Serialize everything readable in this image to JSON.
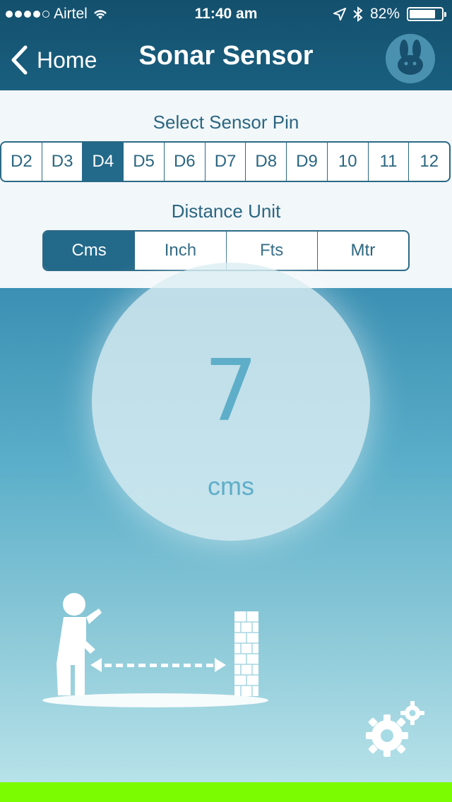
{
  "status_bar": {
    "carrier": "Airtel",
    "time": "11:40 am",
    "battery_percent": "82%",
    "battery_level": 0.82
  },
  "nav": {
    "back_label": "Home",
    "title": "Sonar Sensor",
    "icons": [
      "chevron-left-icon",
      "bunny-icon"
    ]
  },
  "sensor_pin": {
    "label": "Select Sensor Pin",
    "options": [
      "D2",
      "D3",
      "D4",
      "D5",
      "D6",
      "D7",
      "D8",
      "D9",
      "10",
      "11",
      "12"
    ],
    "selected": "D4"
  },
  "distance_unit": {
    "label": "Distance Unit",
    "options": [
      "Cms",
      "Inch",
      "Fts",
      "Mtr"
    ],
    "selected": "Cms"
  },
  "reading": {
    "value": "7",
    "unit": "cms"
  },
  "colors": {
    "header_bg": "#15587a",
    "accent": "#22698a",
    "readout_text": "#5eaec9",
    "bottom_bar": "#7cfc00"
  },
  "illustration": {
    "icons": [
      "person-icon",
      "double-arrow-icon",
      "brick-wall-icon",
      "settings-gear-icon"
    ]
  }
}
